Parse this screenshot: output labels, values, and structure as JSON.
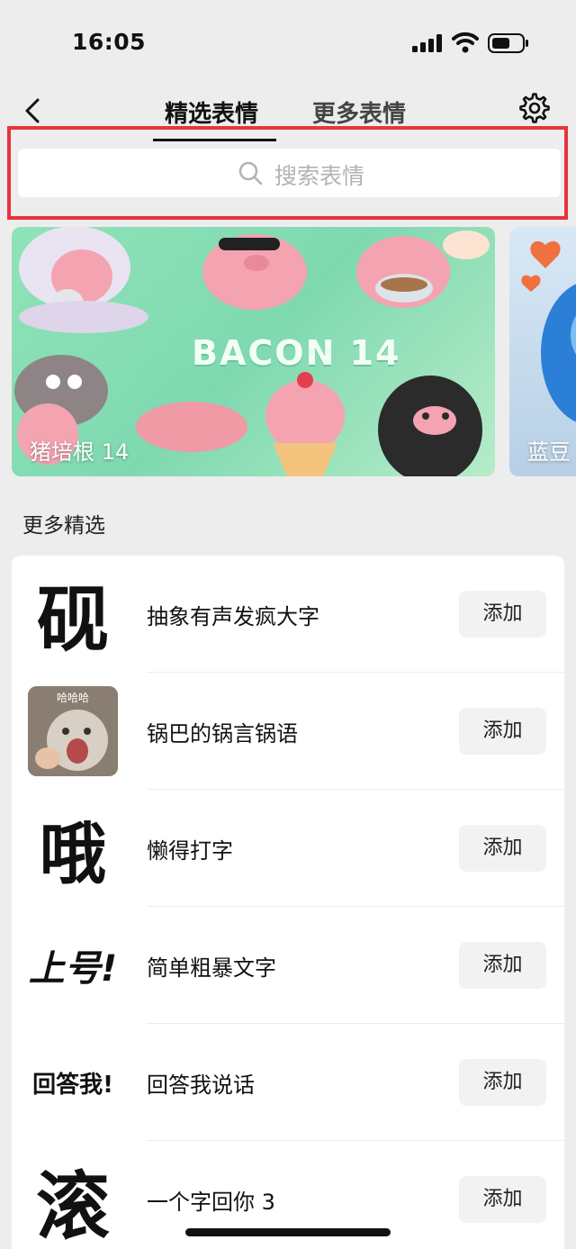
{
  "status_bar": {
    "time": "16:05"
  },
  "nav": {
    "tabs": [
      {
        "label": "精选表情",
        "active": true
      },
      {
        "label": "更多表情",
        "active": false
      }
    ]
  },
  "search": {
    "placeholder": "搜索表情"
  },
  "banners": [
    {
      "art_text": "BACON 14",
      "label": "猪培根 14"
    },
    {
      "label": "蓝豆"
    }
  ],
  "section": {
    "title": "更多精选"
  },
  "items": [
    {
      "thumb_text": "砚",
      "title": "抽象有声发疯大字",
      "action": "添加"
    },
    {
      "thumb_text": "哈哈哈",
      "title": "锅巴的锅言锅语",
      "action": "添加"
    },
    {
      "thumb_text": "哦",
      "title": "懒得打字",
      "action": "添加"
    },
    {
      "thumb_text": "上号!",
      "title": "简单粗暴文字",
      "action": "添加"
    },
    {
      "thumb_text": "回答我!",
      "title": "回答我说话",
      "action": "添加"
    },
    {
      "thumb_text": "滚",
      "title": "一个字回你 3",
      "action": "添加"
    }
  ],
  "colors": {
    "highlight": "#e8343a",
    "banner_bg": "#8fe3b8",
    "page_bg": "#ededed"
  },
  "icons": [
    "back-icon",
    "settings-icon",
    "search-icon",
    "signal-icon",
    "wifi-icon",
    "battery-icon"
  ]
}
